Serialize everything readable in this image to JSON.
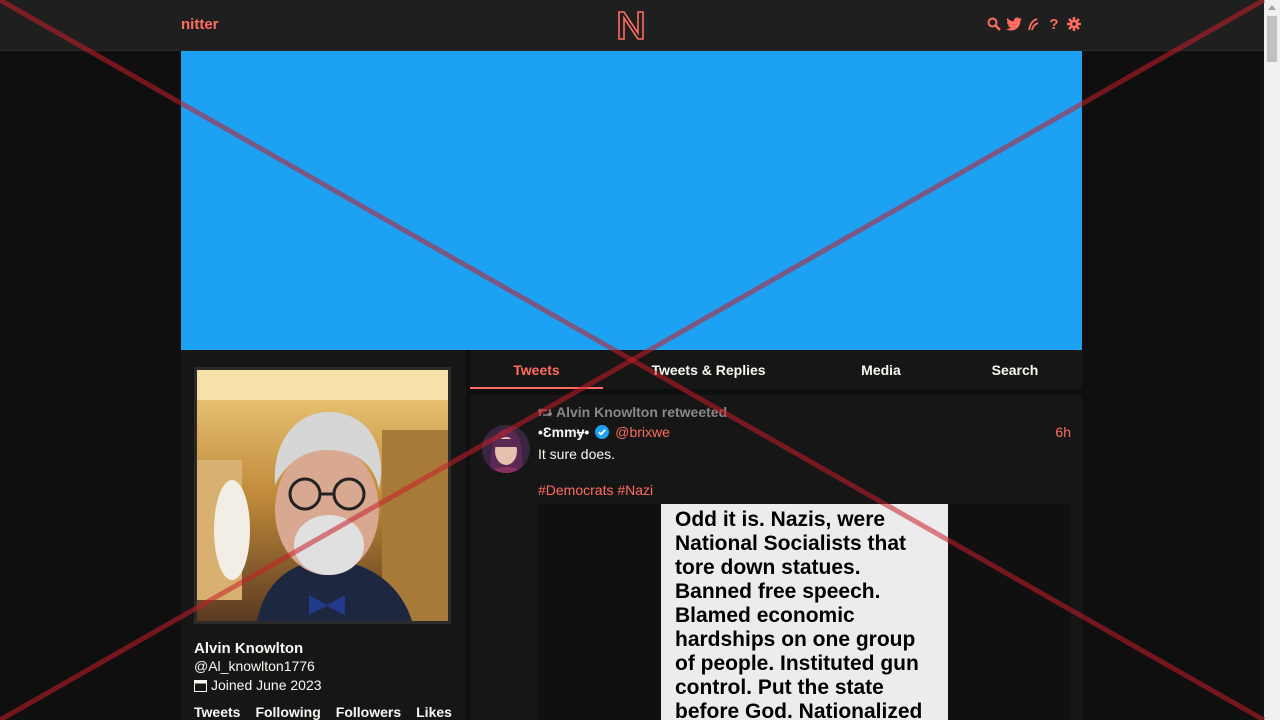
{
  "navbar": {
    "brand": "nitter",
    "logo_letter": "N",
    "icons": [
      "search-icon",
      "twitter-bird-icon",
      "rss-icon",
      "help-icon",
      "gear-icon"
    ]
  },
  "colors": {
    "accent": "#ff6c60",
    "banner": "#1da1f2",
    "background": "#0f0f0f",
    "panel": "#161616"
  },
  "profile": {
    "full_name": "Alvin Knowlton",
    "username": "@Al_knowlton1776",
    "joined": "Joined June 2023",
    "stats": [
      "Tweets",
      "Following",
      "Followers",
      "Likes"
    ]
  },
  "tabs": [
    "Tweets",
    "Tweets & Replies",
    "Media",
    "Search"
  ],
  "tweet": {
    "retweet_header": "Alvin Knowlton retweeted",
    "fullname": "•Ɛmmɏ•",
    "username": "@brixwe",
    "date": "6h",
    "text": "It sure does.",
    "hashtags": "#Democrats #Nazi",
    "image_text": [
      "Odd it is.  Nazis, were",
      "National Socialists that",
      "tore down statues.",
      "Banned free speech.",
      "Blamed economic",
      "hardships on one group",
      "of people. Instituted gun",
      "control. Put the state",
      "before God. Nationalized"
    ]
  }
}
